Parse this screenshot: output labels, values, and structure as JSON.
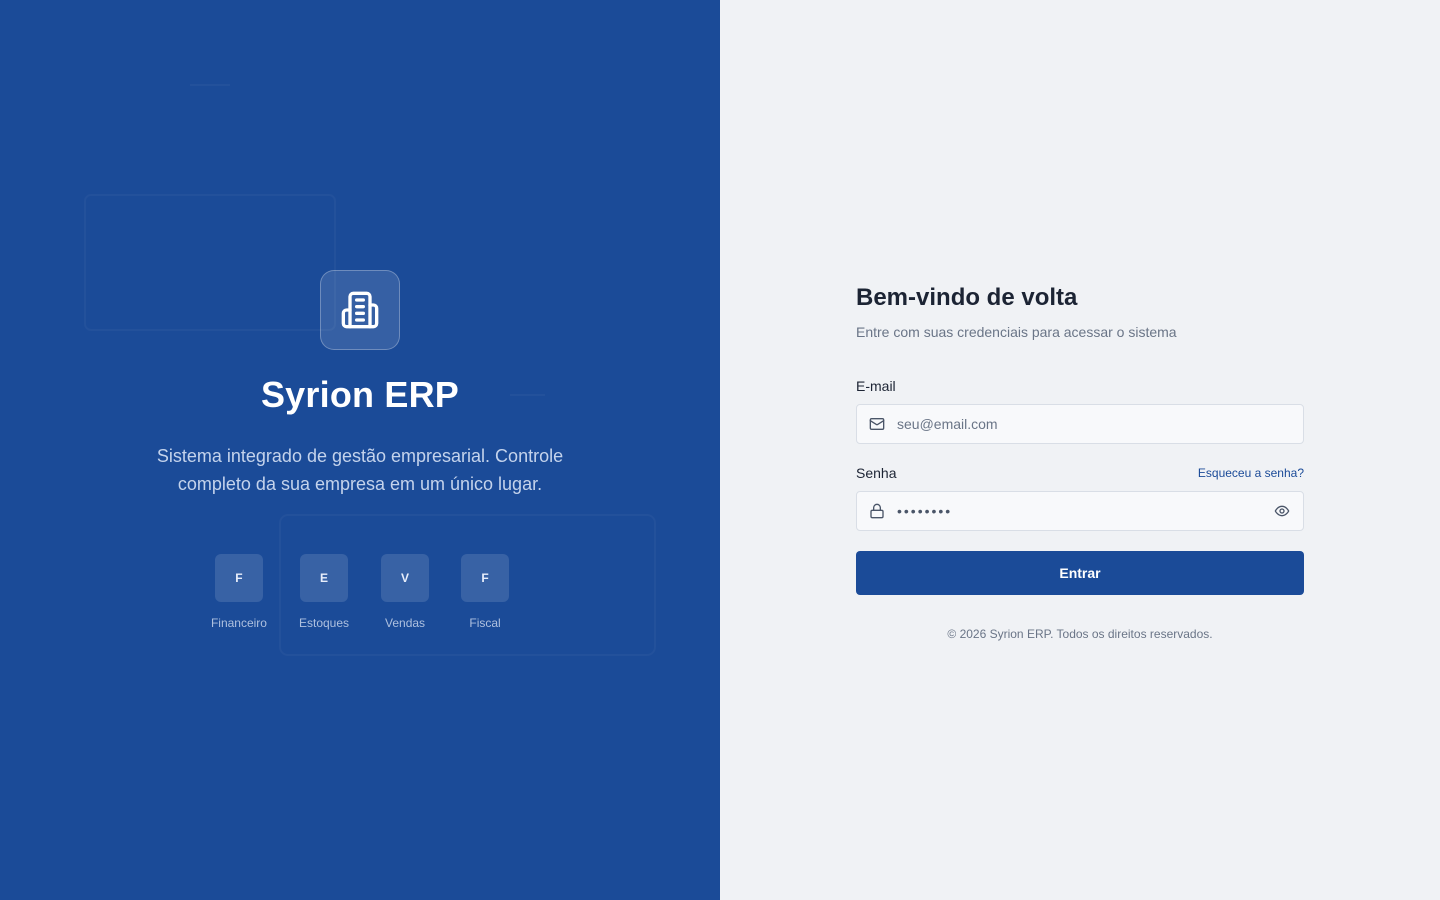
{
  "brand": {
    "name": "Syrion ERP",
    "description": "Sistema integrado de gestão empresarial. Controle completo da sua empresa em um único lugar.",
    "logo_icon": "building-icon"
  },
  "modules": [
    {
      "letter": "F",
      "label": "Financeiro"
    },
    {
      "letter": "E",
      "label": "Estoques"
    },
    {
      "letter": "V",
      "label": "Vendas"
    },
    {
      "letter": "F",
      "label": "Fiscal"
    }
  ],
  "login": {
    "title": "Bem-vindo de volta",
    "subtitle": "Entre com suas credenciais para acessar o sistema",
    "email_label": "E-mail",
    "email_placeholder": "seu@email.com",
    "email_value": "",
    "password_label": "Senha",
    "forgot_link": "Esqueceu a senha?",
    "password_mask": "••••••••",
    "submit_label": "Entrar",
    "footer": "© 2026 Syrion ERP. Todos os direitos reservados."
  },
  "colors": {
    "brand_blue": "#1b4b98",
    "right_bg": "#f0f2f5",
    "text_dark": "#1c2434",
    "text_muted": "#6a7587"
  }
}
